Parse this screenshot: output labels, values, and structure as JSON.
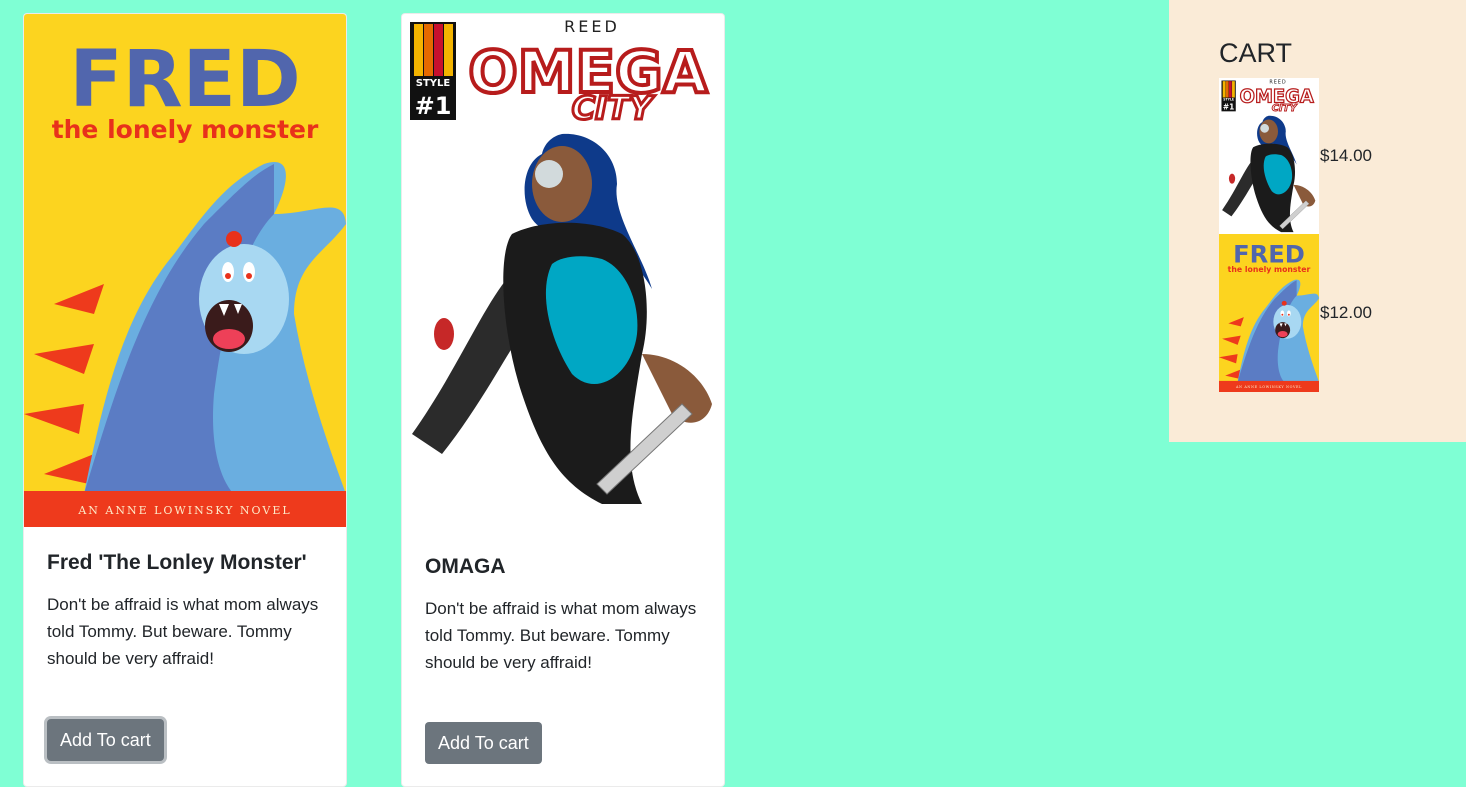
{
  "products": [
    {
      "cover": {
        "title": "FRED",
        "subtitle": "the lonely monster",
        "footer": "AN ANNE LOWINSKY NOVEL"
      },
      "title": "Fred 'The Lonley Monster'",
      "description": "Don't be affraid is what mom always told Tommy. But beware. Tommy should be very affraid!",
      "button_label": "Add To cart"
    },
    {
      "cover": {
        "top_text": "REED",
        "title": "OMEGA",
        "subtitle": "CITY",
        "badge_style": "STYLE",
        "badge_number": "#1"
      },
      "title": "OMAGA",
      "description": "Don't be affraid is what mom always told Tommy. But beware. Tommy should be very affraid!",
      "button_label": "Add To cart"
    }
  ],
  "cart": {
    "title": "CART",
    "items": [
      {
        "price": "$14.00"
      },
      {
        "price": "$12.00"
      }
    ]
  },
  "colors": {
    "page_background": "#7fffd4",
    "cart_background": "#faebd7",
    "button": "#6c757d",
    "fred_yellow": "#fcd41f",
    "fred_blue": "#5b7cc4",
    "fred_red": "#ee3a1c"
  }
}
